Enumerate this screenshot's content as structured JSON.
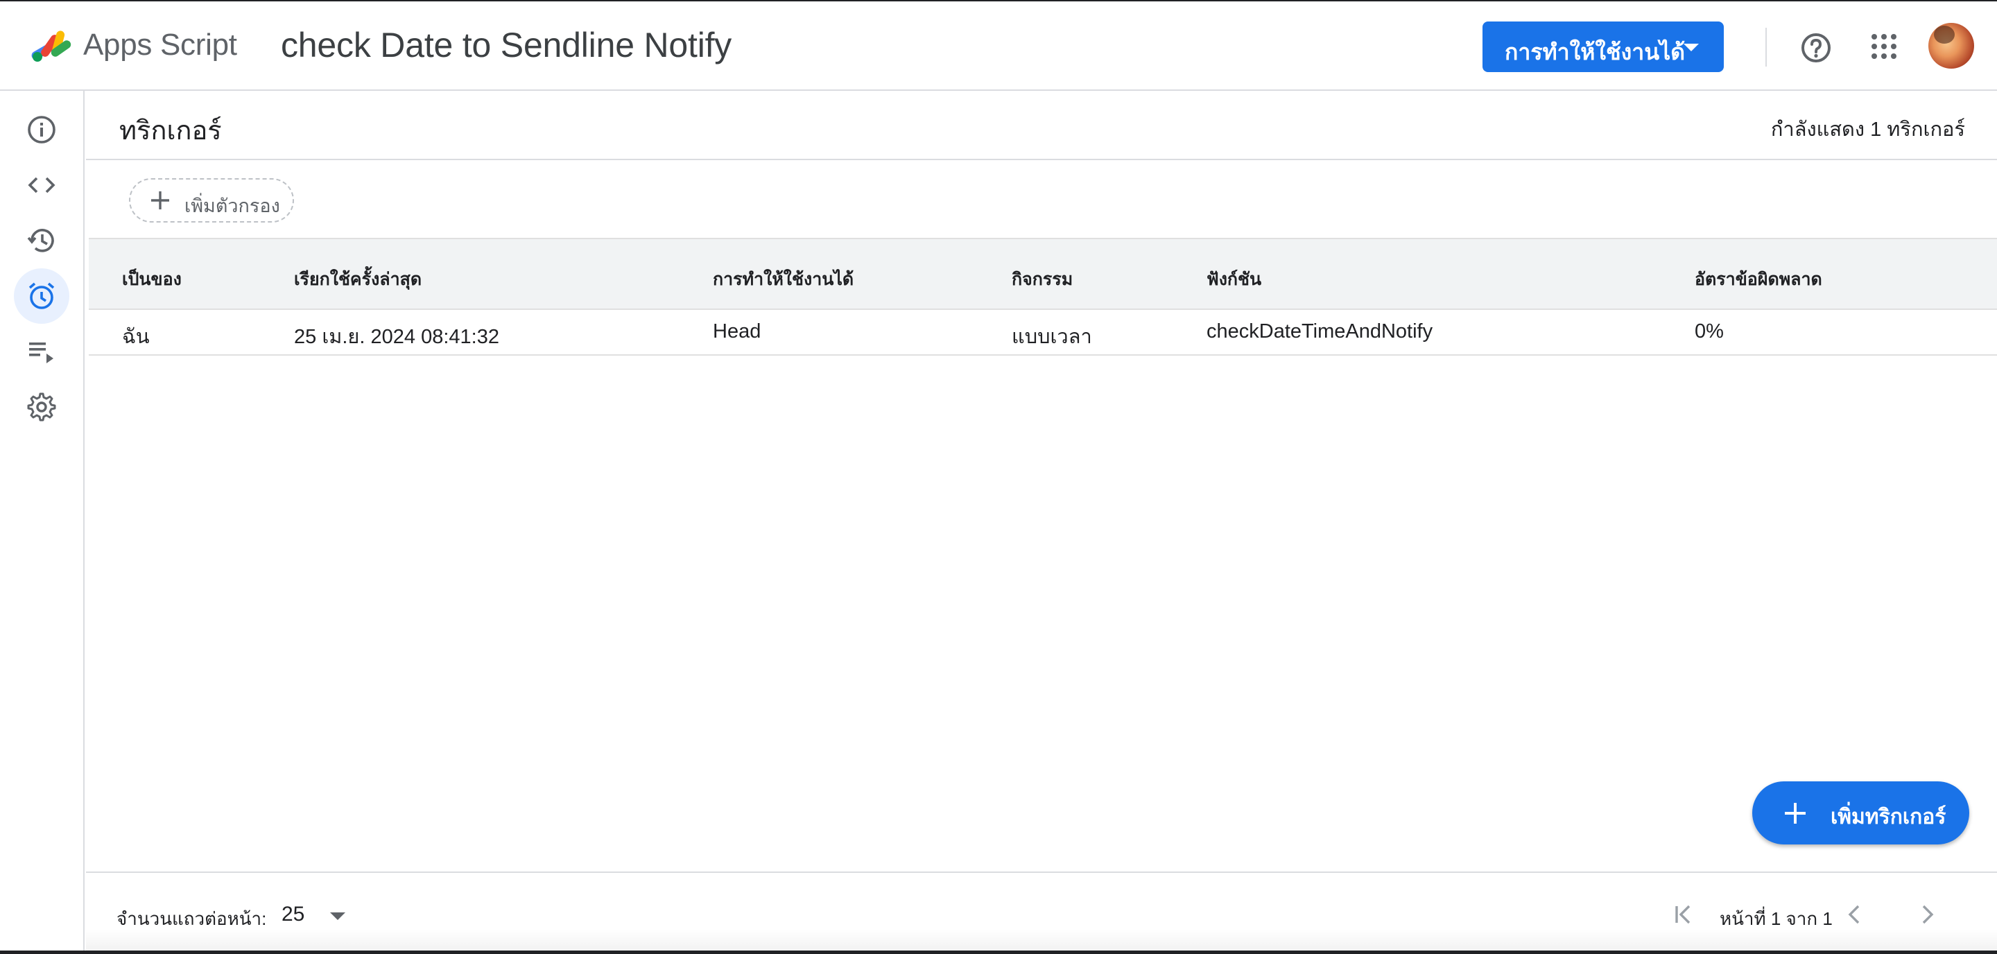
{
  "header": {
    "product_name": "Apps Script",
    "project_title": "check Date to Sendline Notify",
    "deploy_label": "การทำให้ใช้งานได้",
    "icons": [
      "apps-script-logo-icon",
      "help-icon",
      "apps-grid-icon",
      "avatar"
    ]
  },
  "sidebar": {
    "items": [
      {
        "name": "overview",
        "icon": "info-icon"
      },
      {
        "name": "editor",
        "icon": "code-icon"
      },
      {
        "name": "project-history",
        "icon": "history-icon"
      },
      {
        "name": "triggers",
        "icon": "alarm-clock-icon",
        "active": true
      },
      {
        "name": "executions",
        "icon": "playlist-play-icon"
      },
      {
        "name": "settings",
        "icon": "gear-icon"
      }
    ]
  },
  "page": {
    "title": "ทริกเกอร์",
    "count_text": "กำลังแสดง 1 ทริกเกอร์",
    "filter_label": "เพิ่มตัวกรอง"
  },
  "table": {
    "columns": [
      "เป็นของ",
      "เรียกใช้ครั้งล่าสุด",
      "การทำให้ใช้งานได้",
      "กิจกรรม",
      "ฟังก์ชัน",
      "อัตราข้อผิดพลาด"
    ],
    "rows": [
      [
        "ฉัน",
        "25 เม.ย. 2024 08:41:32",
        "Head",
        "แบบเวลา",
        "checkDateTimeAndNotify",
        "0%"
      ]
    ]
  },
  "fab": {
    "label": "เพิ่มทริกเกอร์"
  },
  "footer": {
    "rows_per_page_label": "จำนวนแถวต่อหน้า:",
    "rows_per_page_value": "25",
    "page_label": "หน้าที่ 1 จาก 1"
  },
  "colors": {
    "accent": "#1a73e8",
    "active_rail_bg": "#e8f0fe",
    "header_row_bg": "#f1f3f4",
    "border": "#dadce0"
  }
}
